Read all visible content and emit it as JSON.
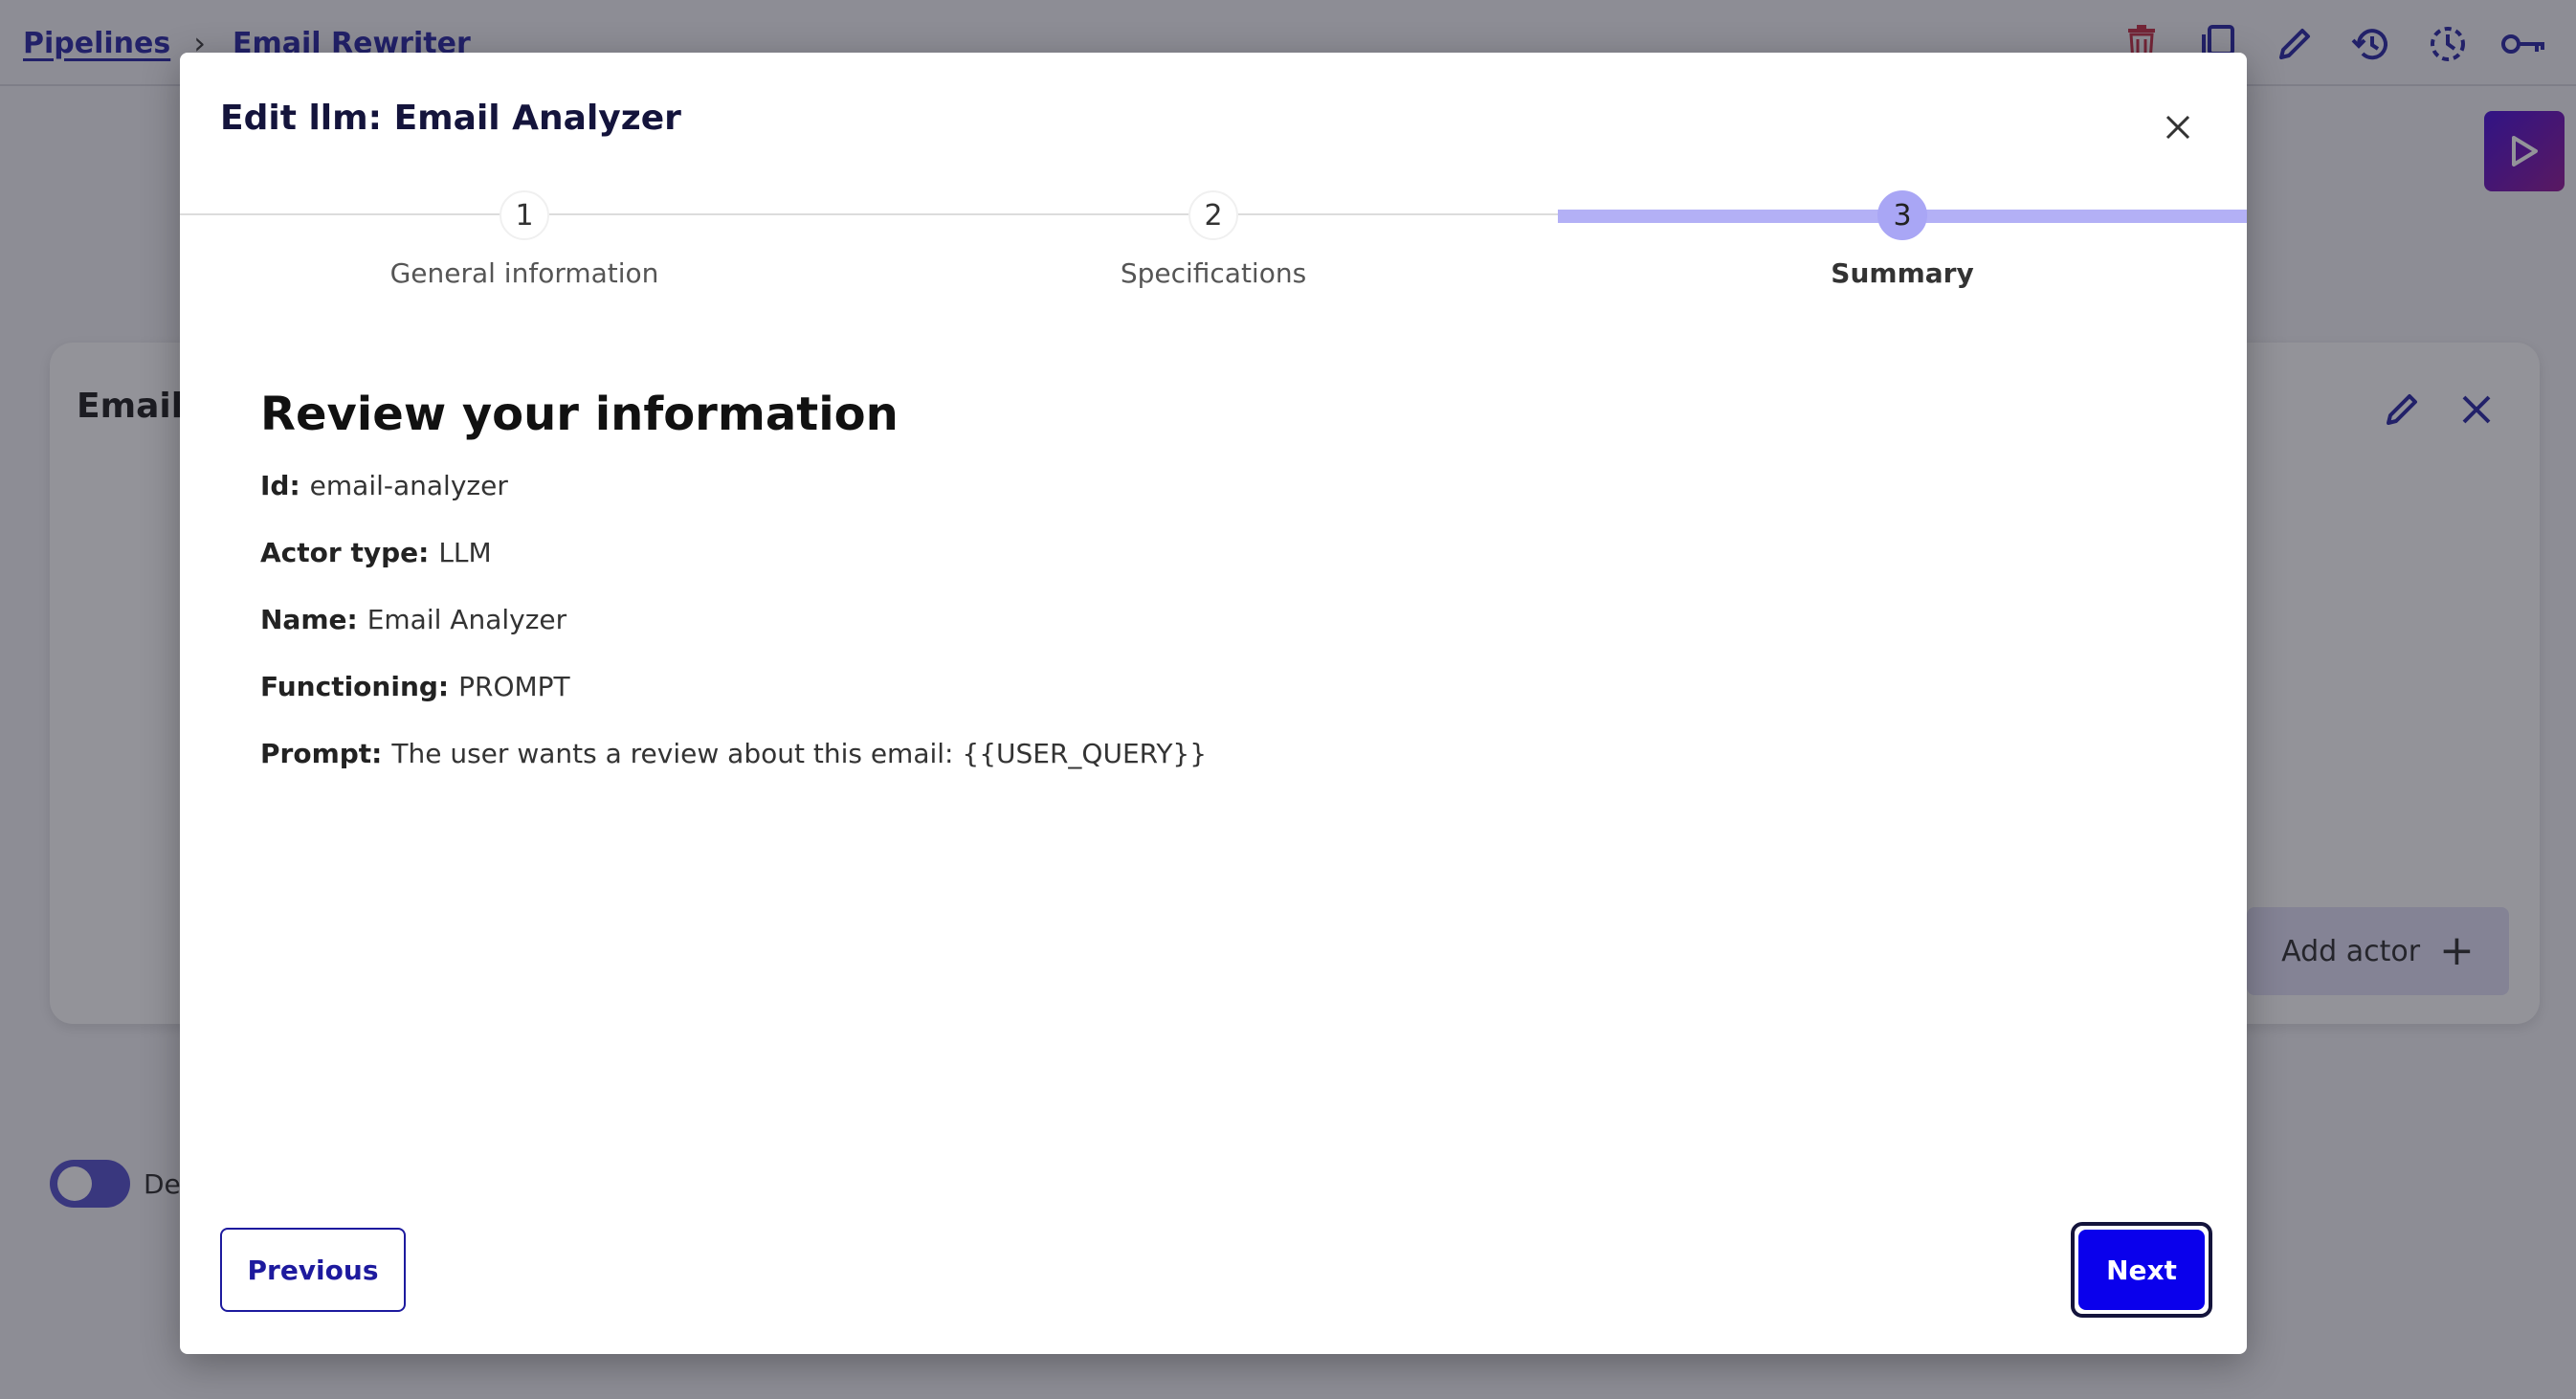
{
  "breadcrumb": {
    "root": "Pipelines",
    "current": "Email Rewriter"
  },
  "toolbar_icons": [
    "delete-icon",
    "copy-icon",
    "edit-icon",
    "history-icon",
    "schedule-icon",
    "key-icon"
  ],
  "colors": {
    "primary": "#0a00ec",
    "brand_dark": "#14143c",
    "link": "#1d1a9e",
    "step_active": "#a9a6f5",
    "danger": "#c0233a"
  },
  "card": {
    "title": "Email",
    "add_actor_label": "Add actor"
  },
  "toggle": {
    "label": "De",
    "on": true
  },
  "modal": {
    "title": "Edit llm: Email Analyzer",
    "steps": [
      {
        "number": "1",
        "label": "General information",
        "active": false
      },
      {
        "number": "2",
        "label": "Specifications",
        "active": false
      },
      {
        "number": "3",
        "label": "Summary",
        "active": true
      }
    ],
    "review_heading": "Review your information",
    "fields": [
      {
        "key": "Id:",
        "value": "email-analyzer"
      },
      {
        "key": "Actor type:",
        "value": "LLM"
      },
      {
        "key": "Name:",
        "value": "Email Analyzer"
      },
      {
        "key": "Functioning:",
        "value": "PROMPT"
      },
      {
        "key": "Prompt:",
        "value": "The user wants a review about this email: {{USER_QUERY}}"
      }
    ],
    "previous_label": "Previous",
    "next_label": "Next"
  }
}
